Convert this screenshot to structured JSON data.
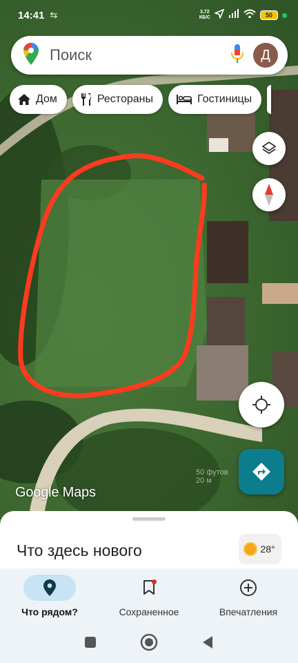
{
  "status": {
    "time": "14:41",
    "speed_top": "3,72",
    "speed_bottom": "КБ/С",
    "battery": "50"
  },
  "search": {
    "placeholder": "Поиск",
    "avatar_letter": "Д"
  },
  "chips": [
    {
      "label": "Дом",
      "icon": "home-icon"
    },
    {
      "label": "Рестораны",
      "icon": "restaurant-icon"
    },
    {
      "label": "Гостиницы",
      "icon": "hotel-icon"
    }
  ],
  "map": {
    "watermark": "Google Maps",
    "scale_top": "50 футов",
    "scale_bottom": "20 м",
    "drawing_color": "#ff3b1f"
  },
  "sheet": {
    "title": "Что здесь нового",
    "temperature": "28°"
  },
  "bottom_nav": [
    {
      "label": "Что рядом?",
      "icon": "location-pin-icon",
      "active": true
    },
    {
      "label": "Сохраненное",
      "icon": "bookmark-icon",
      "active": false
    },
    {
      "label": "Впечатления",
      "icon": "add-circle-icon",
      "active": false
    }
  ]
}
